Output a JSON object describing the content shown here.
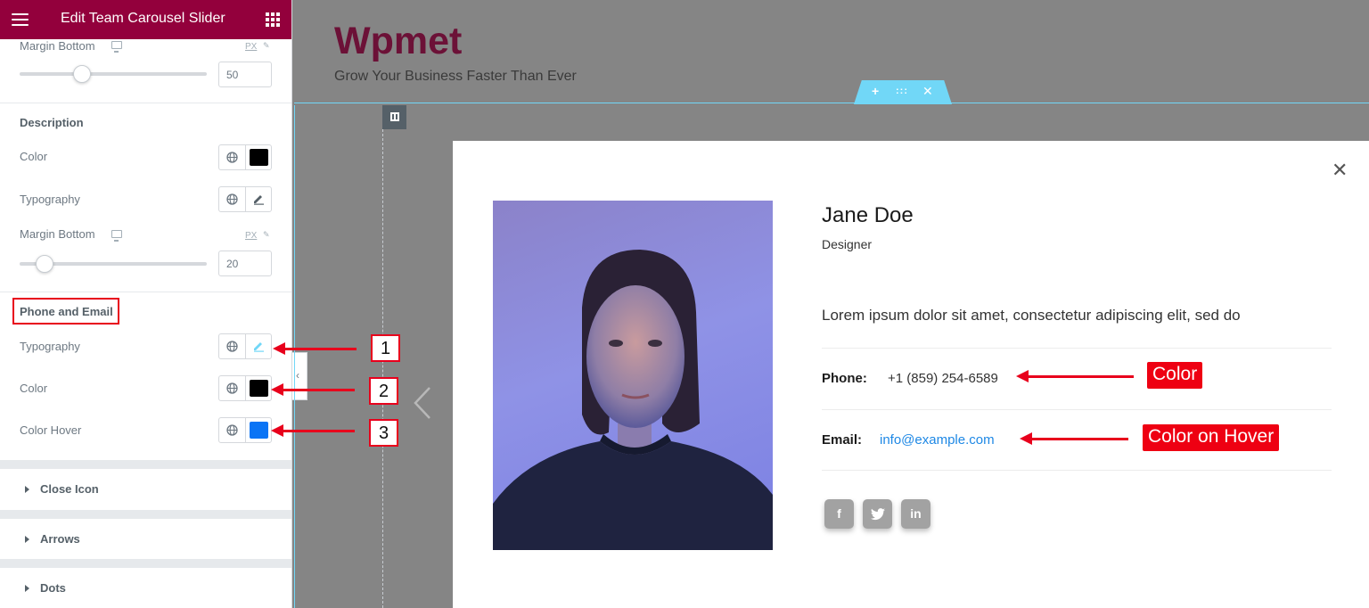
{
  "header": {
    "title": "Edit Team Carousel Slider"
  },
  "panel": {
    "top_margin": {
      "label": "Margin Bottom",
      "unit": "PX",
      "value": "50",
      "fraction": 0.33
    },
    "description": {
      "title": "Description",
      "color_label": "Color",
      "color_value": "#000000",
      "typography_label": "Typography",
      "margin_label": "Margin Bottom",
      "margin_unit": "PX",
      "margin_value": "20",
      "margin_fraction": 0.13
    },
    "phone_email": {
      "title": "Phone and Email",
      "typography_label": "Typography",
      "color_label": "Color",
      "color_value": "#000000",
      "hover_label": "Color Hover",
      "hover_value": "#0a74f5"
    },
    "collapsed_sections": [
      "Close Icon",
      "Arrows",
      "Dots"
    ]
  },
  "site": {
    "brand": "Wpmet",
    "tagline": "Grow Your Business Faster Than Ever"
  },
  "modal": {
    "name": "Jane Doe",
    "role": "Designer",
    "description": "Lorem ipsum dolor sit amet, consectetur adipiscing elit, sed do",
    "phone_label": "Phone:",
    "phone_value": "+1 (859) 254-6589",
    "email_label": "Email:",
    "email_value": "info@example.com",
    "socials": [
      "f",
      "t",
      "in"
    ]
  },
  "annotations": {
    "numbers": [
      "1",
      "2",
      "3"
    ],
    "color_label": "Color",
    "hover_label": "Color on Hover",
    "accent": "#e8001c"
  }
}
